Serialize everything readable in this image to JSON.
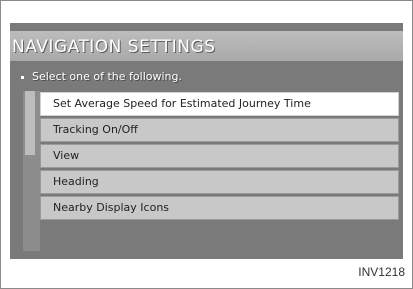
{
  "screen": {
    "title": "NAVIGATION SETTINGS",
    "instruction": "Select one of the following.",
    "menu_items": [
      "Set Average Speed for Estimated Journey Time",
      "Tracking On/Off",
      "View",
      "Heading",
      "Nearby Display Icons"
    ],
    "selected_index": 0
  },
  "figure_code": "INV1218",
  "colors": {
    "screen_bg": "#7a7a7a",
    "selected_item": "#ffffff",
    "menu_item": "#c8c8c8"
  }
}
